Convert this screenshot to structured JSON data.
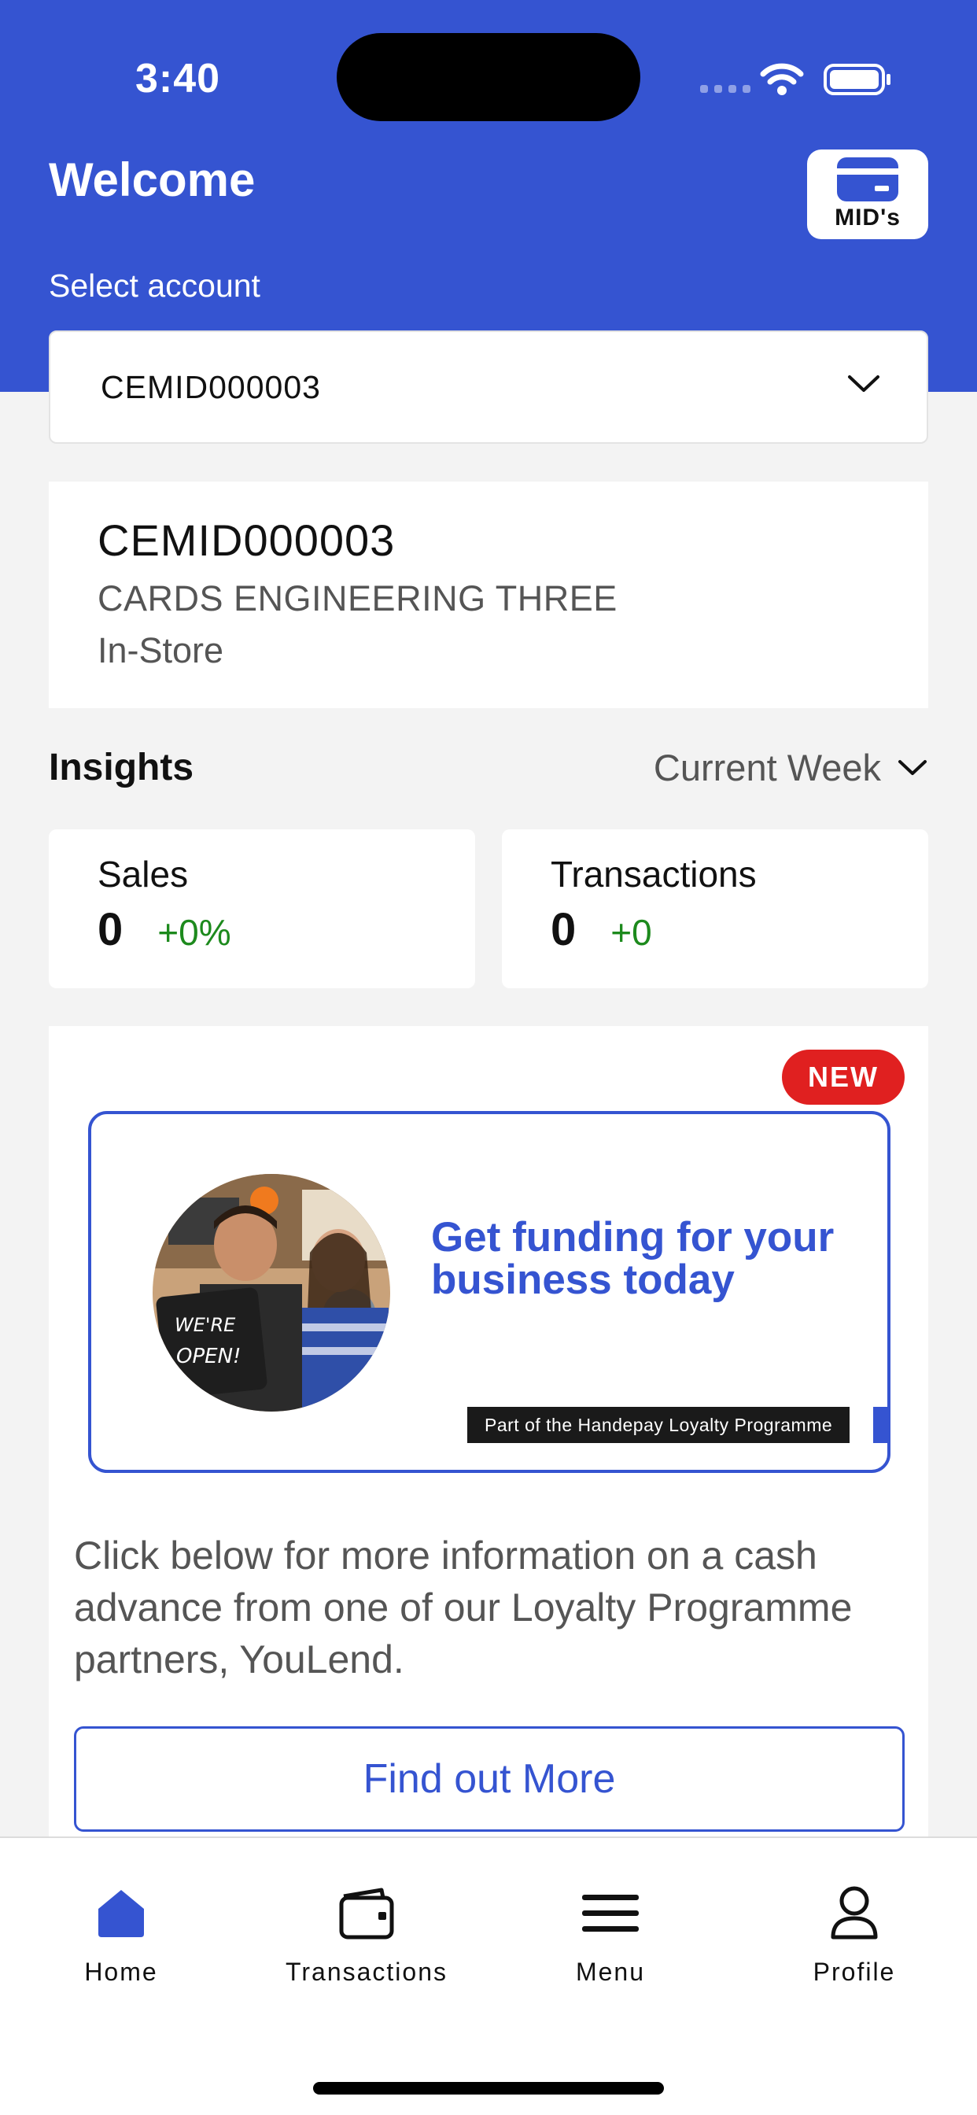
{
  "status_bar": {
    "time": "3:40"
  },
  "header": {
    "title": "Welcome",
    "mids_button_label": "MID's",
    "select_label": "Select account",
    "selected_account": "CEMID000003"
  },
  "account_card": {
    "id": "CEMID000003",
    "name": "CARDS ENGINEERING THREE",
    "type": "In-Store"
  },
  "insights": {
    "title": "Insights",
    "period": "Current Week",
    "sales": {
      "label": "Sales",
      "value": "0",
      "change": "+0%"
    },
    "transactions": {
      "label": "Transactions",
      "value": "0",
      "change": "+0"
    }
  },
  "promo": {
    "badge": "NEW",
    "banner_heading": "Get funding for your business today",
    "banner_tag": "Part of the Handepay Loyalty Programme",
    "photo_sign_text": "WE'RE OPEN!",
    "description": "Click below for more information on a cash advance from one of our Loyalty Programme partners, YouLend.",
    "button_label": "Find out More"
  },
  "tab_bar": {
    "items": [
      {
        "label": "Home",
        "icon": "home-icon",
        "active": true
      },
      {
        "label": "Transactions",
        "icon": "wallet-icon",
        "active": false
      },
      {
        "label": "Menu",
        "icon": "menu-icon",
        "active": false
      },
      {
        "label": "Profile",
        "icon": "profile-icon",
        "active": false
      }
    ]
  },
  "colors": {
    "brand_blue": "#3554d1",
    "positive_green": "#1d8a1d",
    "badge_red": "#e02020",
    "background": "#f3f3f3"
  }
}
